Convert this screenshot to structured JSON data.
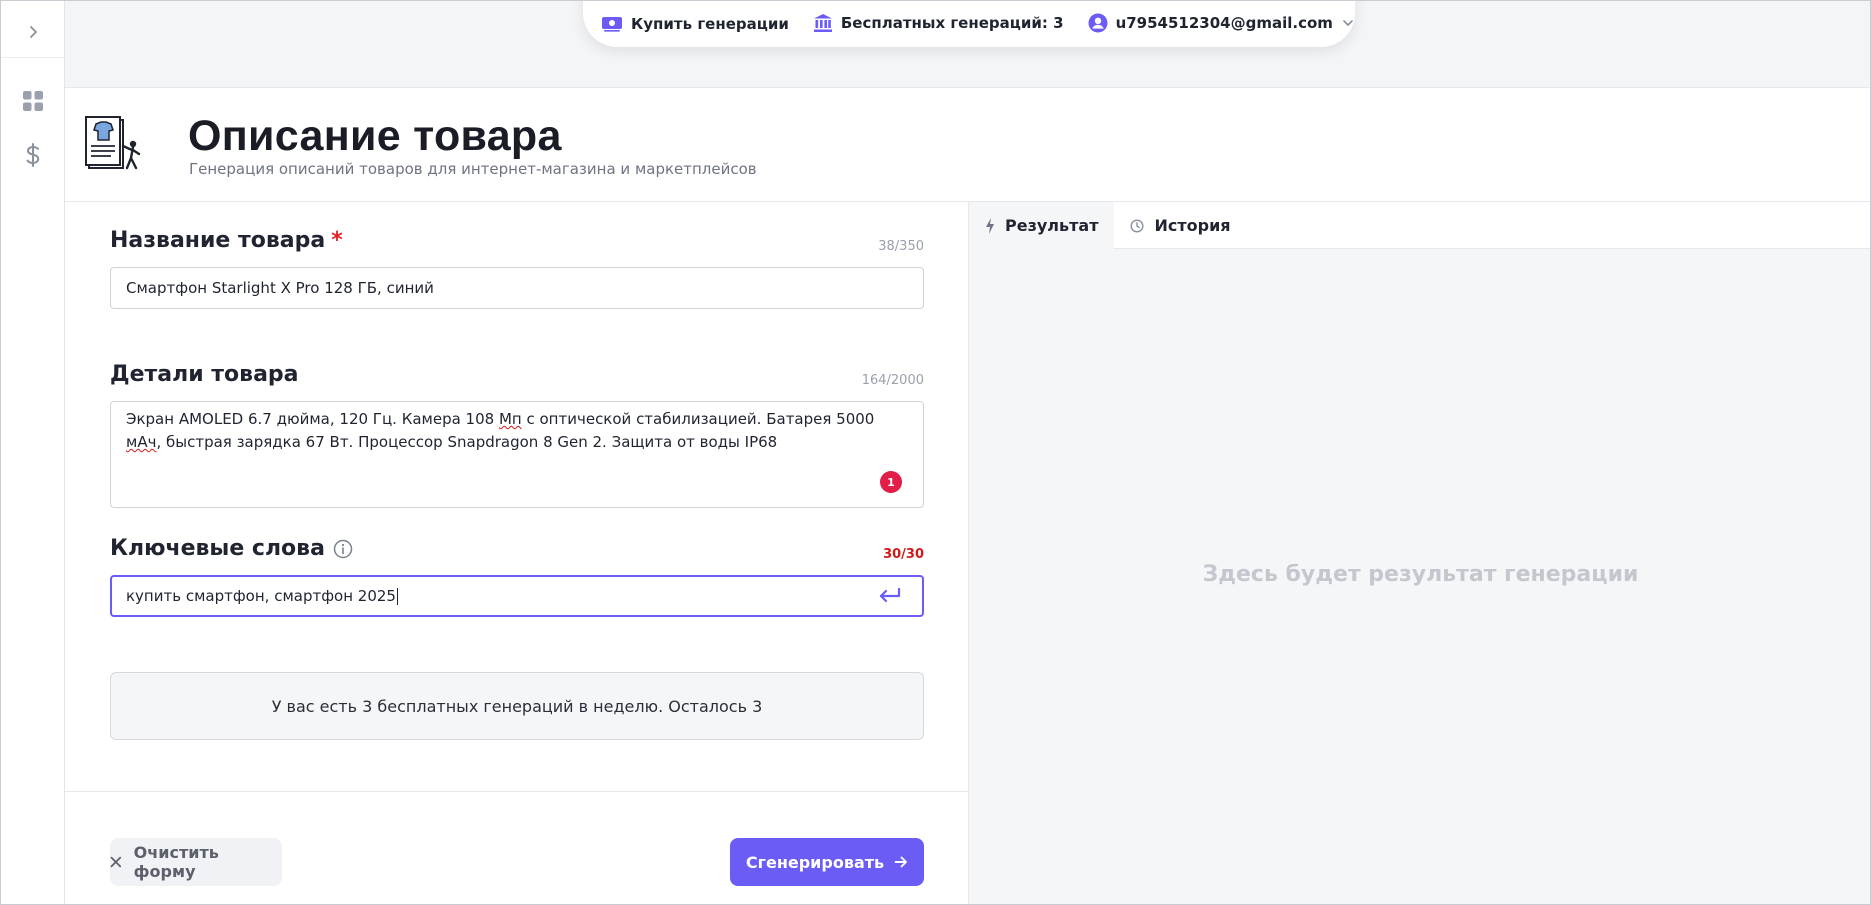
{
  "topbar": {
    "buy_label": "Купить генерации",
    "free_label": "Бесплатных генераций: 3",
    "account_email": "u7954512304@gmail.com"
  },
  "header": {
    "title": "Описание товара",
    "subtitle": "Генерация описаний товаров для интернет-магазина и маркетплейсов"
  },
  "form": {
    "name": {
      "label": "Название товара",
      "required_mark": "*",
      "counter": "38/350",
      "value": "Смартфон Starlight X Pro 128 ГБ, синий"
    },
    "details": {
      "label": "Детали товара",
      "counter": "164/2000",
      "value_part1": "Экран AMOLED 6.7 дюйма, 120 Гц. Камера 108 ",
      "value_spell1": "Мп",
      "value_part2": " с оптической стабилизацией. Батарея 5000 ",
      "value_spell2": "мАч",
      "value_part3": ", быстрая зарядка 67 Вт. Процессор Snapdragon 8 Gen 2. Защита от воды IP68",
      "error_count": "1"
    },
    "keywords": {
      "label": "Ключевые слова",
      "counter": "30/30",
      "value": "купить смартфон, смартфон 2025"
    },
    "info_text": "У вас есть 3 бесплатных генераций в неделю. Осталось 3",
    "clear_label": "Очистить форму",
    "generate_label": "Сгенерировать"
  },
  "result": {
    "tabs": [
      {
        "label": "Результат"
      },
      {
        "label": "История"
      }
    ],
    "placeholder": "Здесь будет результат генерации"
  },
  "colors": {
    "accent": "#6b5cf6",
    "error": "#e11d48"
  }
}
